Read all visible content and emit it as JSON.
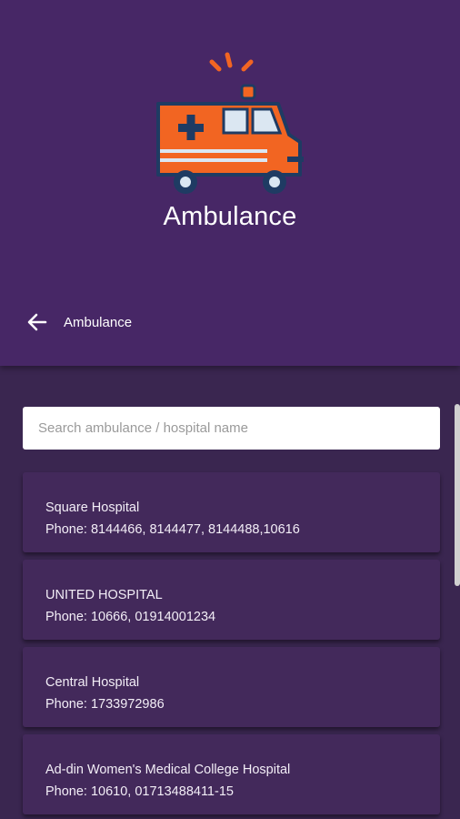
{
  "app": {
    "title": "Ambulance"
  },
  "toolbar": {
    "title": "Ambulance",
    "back_icon": "arrow-left-icon"
  },
  "search": {
    "placeholder": "Search ambulance / hospital name",
    "value": ""
  },
  "hospitals": [
    {
      "name": "Square Hospital",
      "phone": "Phone: 8144466, 8144477, 8144488,10616"
    },
    {
      "name": "UNITED HOSPITAL",
      "phone": "Phone: 10666, 01914001234"
    },
    {
      "name": "Central Hospital",
      "phone": "Phone: 1733972986"
    },
    {
      "name": "Ad-din Women's Medical College Hospital",
      "phone": "Phone: 10610, 01713488411-15"
    }
  ],
  "colors": {
    "header": "#472766",
    "background": "#3a2650",
    "card": "#43295b",
    "ambulance_body": "#f26522",
    "outline": "#1f3b63"
  }
}
